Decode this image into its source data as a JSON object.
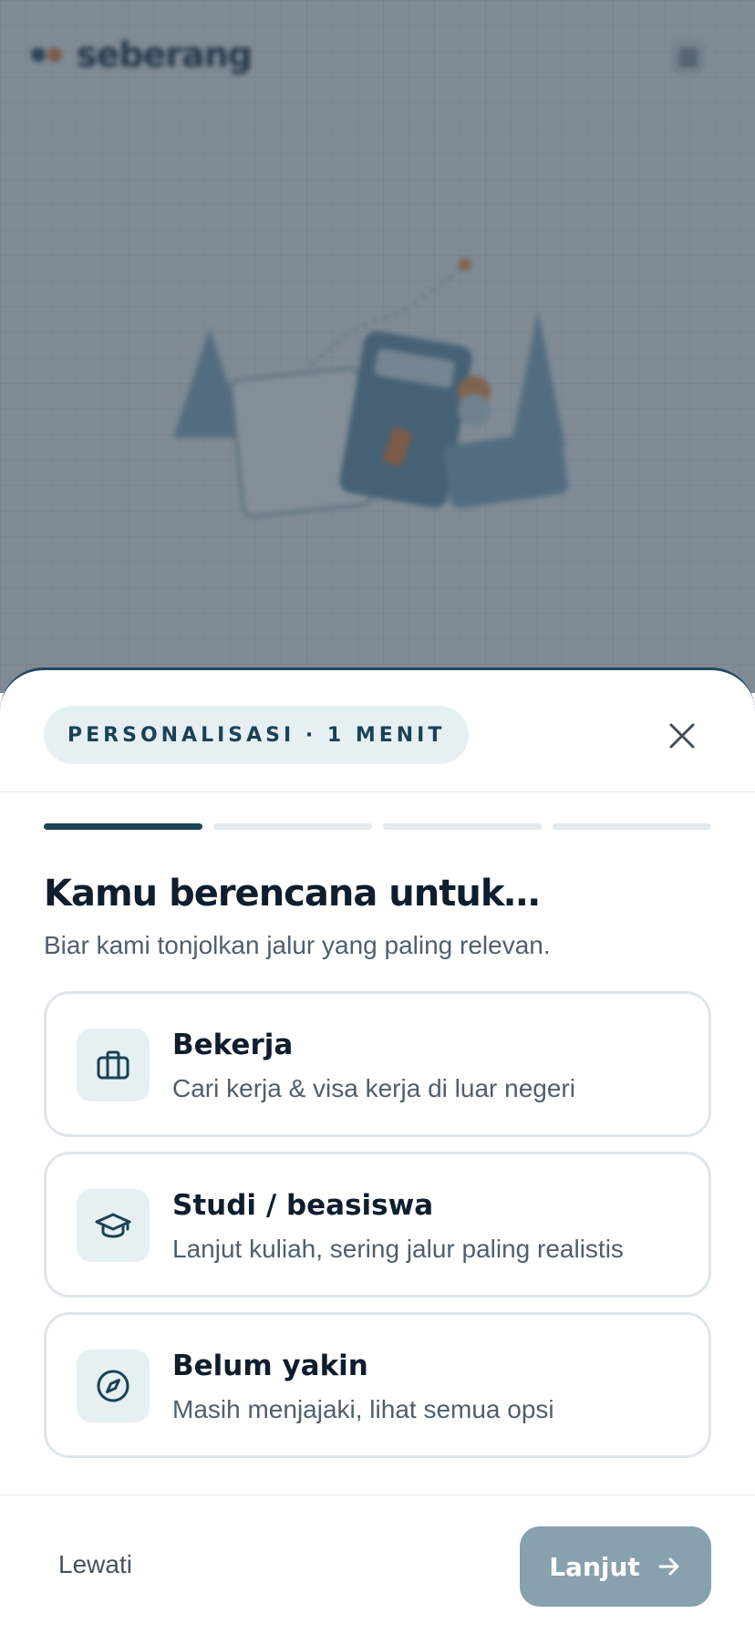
{
  "background": {
    "logo_text": "seberang"
  },
  "sheet": {
    "badge": "PERSONALISASI · 1 MENIT",
    "close_icon": "close-icon",
    "progress": {
      "current_step": 1,
      "total_steps": 4
    },
    "title": "Kamu berencana untuk…",
    "subtitle": "Biar kami tonjolkan jalur yang paling relevan.",
    "options": [
      {
        "icon": "briefcase-icon",
        "title": "Bekerja",
        "description": "Cari kerja & visa kerja di luar negeri"
      },
      {
        "icon": "graduation-cap-icon",
        "title": "Studi / beasiswa",
        "description": "Lanjut kuliah, sering jalur paling realistis"
      },
      {
        "icon": "compass-icon",
        "title": "Belum yakin",
        "description": "Masih menjajaki, lihat semua opsi"
      }
    ],
    "footer": {
      "skip_label": "Lewati",
      "next_label": "Lanjut",
      "next_icon": "arrow-right-icon"
    }
  },
  "colors": {
    "primary": "#1c4254",
    "badge_bg": "#e6f0f2",
    "next_button_disabled": "#87a1ad",
    "backdrop_dim": "#344452"
  }
}
